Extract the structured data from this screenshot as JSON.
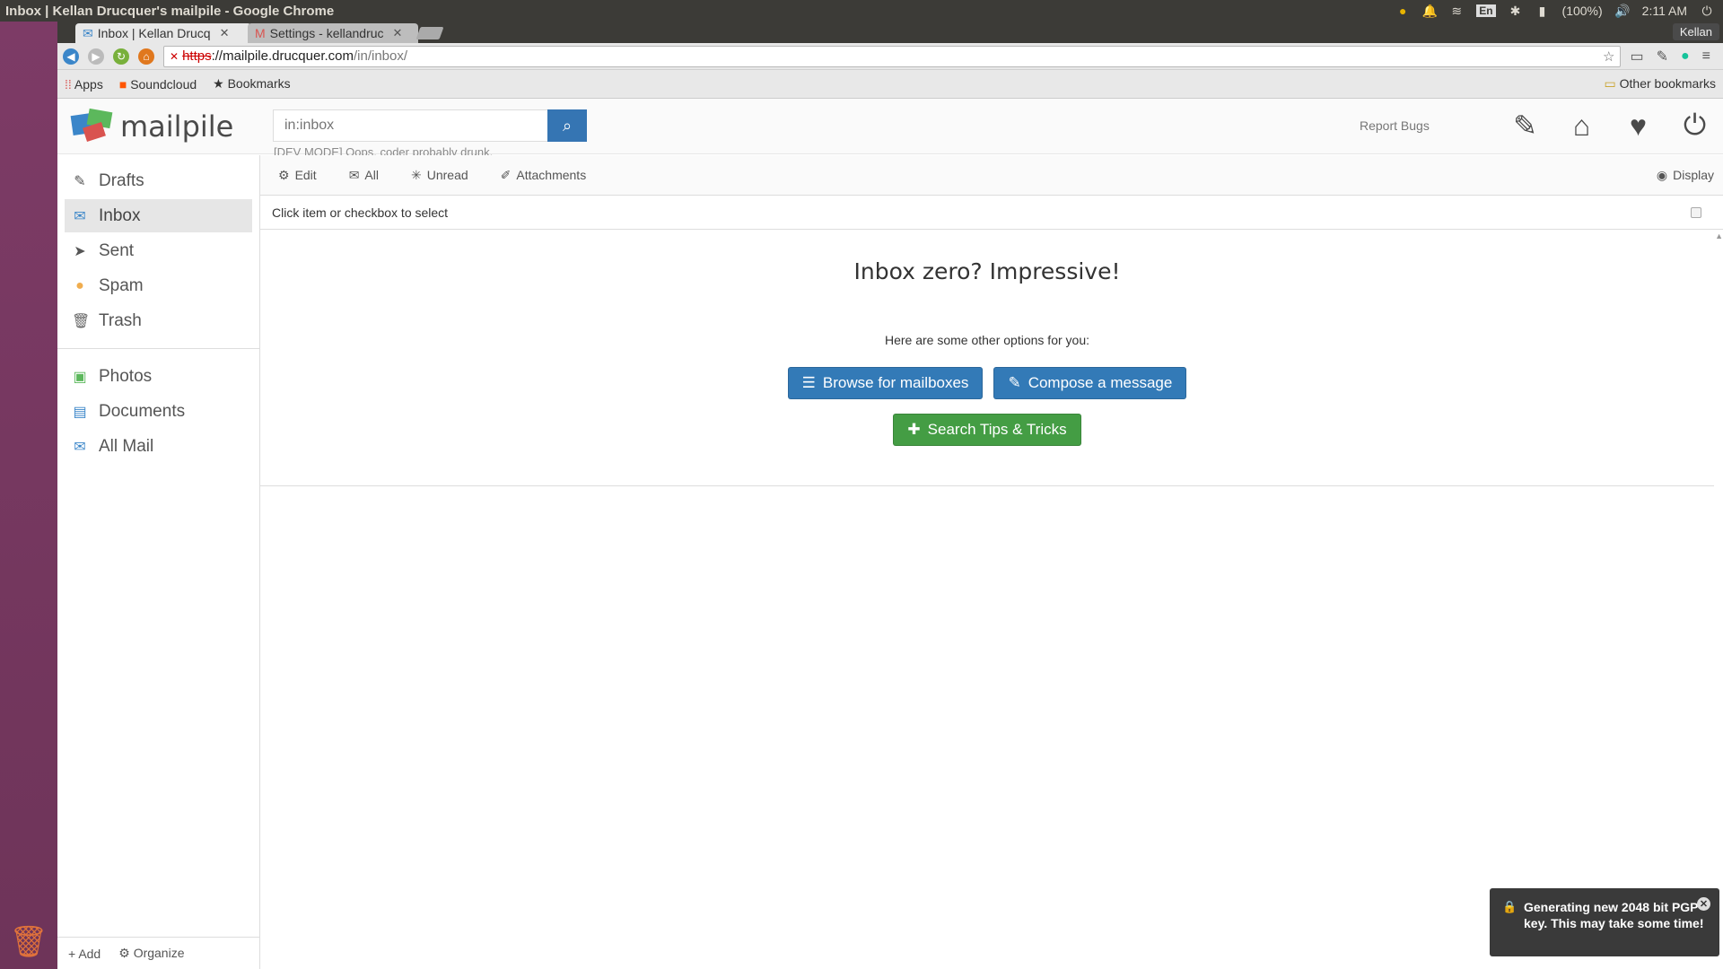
{
  "os": {
    "window_title": "Inbox | Kellan Drucquer's mailpile - Google Chrome",
    "tray": {
      "keyboard": "En",
      "battery": "(100%)",
      "time": "2:11 AM"
    }
  },
  "browser": {
    "tabs": [
      {
        "label": "Inbox | Kellan Drucq"
      },
      {
        "label": "Settings - kellandruc"
      }
    ],
    "profile": "Kellan",
    "url": {
      "scheme": "https",
      "rest": "://mailpile.drucquer.com",
      "path": "/in/inbox/"
    },
    "bookmarks": {
      "apps": "Apps",
      "soundcloud": "Soundcloud",
      "bookmarks": "Bookmarks",
      "other": "Other bookmarks"
    }
  },
  "mailpile": {
    "logo_text": "mailpile",
    "search": {
      "placeholder": "in:inbox"
    },
    "dev_mode": "[DEV MODE] Oops, coder probably drunk.",
    "report_bugs": "Report Bugs",
    "sidebar": {
      "items": [
        {
          "label": "Drafts",
          "icon": "pencil-icon"
        },
        {
          "label": "Inbox",
          "icon": "envelope-icon"
        },
        {
          "label": "Sent",
          "icon": "paper-plane-icon"
        },
        {
          "label": "Spam",
          "icon": "spam-icon"
        },
        {
          "label": "Trash",
          "icon": "trash-icon"
        }
      ],
      "tags": [
        {
          "label": "Photos",
          "icon": "camera-icon"
        },
        {
          "label": "Documents",
          "icon": "document-icon"
        },
        {
          "label": "All Mail",
          "icon": "mail-stack-icon"
        }
      ],
      "add": "Add",
      "organize": "Organize"
    },
    "subbar": {
      "edit": "Edit",
      "all": "All",
      "unread": "Unread",
      "attachments": "Attachments",
      "display": "Display"
    },
    "select_hint": "Click item or checkbox to select",
    "empty": {
      "title": "Inbox zero? Impressive!",
      "subtitle": "Here are some other options for you:",
      "browse": "Browse for mailboxes",
      "compose": "Compose a message",
      "tips": "Search Tips & Tricks"
    },
    "toast": "Generating new 2048 bit PGP key. This may take some time!"
  },
  "colors": {
    "primary": "#337ab7",
    "success": "#449d44",
    "launcher": "#7d3b66"
  }
}
